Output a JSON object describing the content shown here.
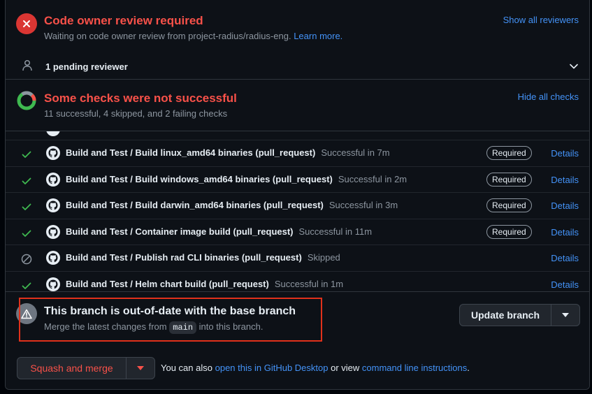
{
  "code_owner": {
    "title": "Code owner review required",
    "description": "Waiting on code owner review from project-radius/radius-eng.",
    "learn_more": "Learn more.",
    "show_reviewers": "Show all reviewers"
  },
  "pending": {
    "label": "1 pending reviewer"
  },
  "checks": {
    "title": "Some checks were not successful",
    "summary": "11 successful, 4 skipped, and 2 failing checks",
    "hide_label": "Hide all checks",
    "items": [
      {
        "name": "Build and Test / Build linux_amd64 binaries (pull_request)",
        "status_text": "Successful in 7m",
        "state": "success",
        "required": "Required",
        "details": "Details"
      },
      {
        "name": "Build and Test / Build windows_amd64 binaries (pull_request)",
        "status_text": "Successful in 2m",
        "state": "success",
        "required": "Required",
        "details": "Details"
      },
      {
        "name": "Build and Test / Build darwin_amd64 binaries (pull_request)",
        "status_text": "Successful in 3m",
        "state": "success",
        "required": "Required",
        "details": "Details"
      },
      {
        "name": "Build and Test / Container image build (pull_request)",
        "status_text": "Successful in 11m",
        "state": "success",
        "required": "Required",
        "details": "Details"
      },
      {
        "name": "Build and Test / Publish rad CLI binaries (pull_request)",
        "status_text": "Skipped",
        "state": "skipped",
        "required": "",
        "details": "Details"
      },
      {
        "name": "Build and Test / Helm chart build (pull_request)",
        "status_text": "Successful in 1m",
        "state": "success",
        "required": "",
        "details": "Details"
      }
    ]
  },
  "branch": {
    "title": "This branch is out-of-date with the base branch",
    "desc_prefix": "Merge the latest changes from",
    "base_branch": "main",
    "desc_suffix": "into this branch.",
    "update_label": "Update branch"
  },
  "merge": {
    "button_label": "Squash and merge",
    "also_prefix": "You can also",
    "desktop_link": "open this in GitHub Desktop",
    "or_view": "or view",
    "cli_link": "command line instructions",
    "period": "."
  },
  "colors": {
    "danger": "#f85149",
    "success": "#3fb950",
    "link": "#4493f8",
    "muted": "#8d96a0",
    "highlight_box": "#e0311b"
  }
}
